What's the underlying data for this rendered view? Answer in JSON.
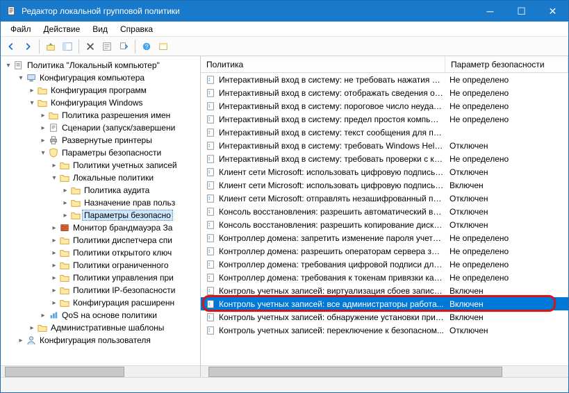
{
  "window": {
    "title": "Редактор локальной групповой политики"
  },
  "menu": {
    "file": "Файл",
    "action": "Действие",
    "view": "Вид",
    "help": "Справка"
  },
  "tree": {
    "root": "Политика \"Локальный компьютер\"",
    "items": [
      {
        "label": "Конфигурация компьютера",
        "depth": 1,
        "expanded": true,
        "icon": "computer"
      },
      {
        "label": "Конфигурация программ",
        "depth": 2,
        "expanded": false,
        "icon": "folder"
      },
      {
        "label": "Конфигурация Windows",
        "depth": 2,
        "expanded": true,
        "icon": "folder"
      },
      {
        "label": "Политика разрешения имен",
        "depth": 3,
        "expanded": false,
        "icon": "folder"
      },
      {
        "label": "Сценарии (запуск/завершени",
        "depth": 3,
        "expanded": false,
        "icon": "script"
      },
      {
        "label": "Развернутые принтеры",
        "depth": 3,
        "expanded": false,
        "icon": "printer"
      },
      {
        "label": "Параметры безопасности",
        "depth": 3,
        "expanded": true,
        "icon": "shield"
      },
      {
        "label": "Политики учетных записей",
        "depth": 4,
        "expanded": false,
        "icon": "folder"
      },
      {
        "label": "Локальные политики",
        "depth": 4,
        "expanded": true,
        "icon": "folder"
      },
      {
        "label": "Политика аудита",
        "depth": 5,
        "expanded": false,
        "icon": "folder"
      },
      {
        "label": "Назначение прав польз",
        "depth": 5,
        "expanded": false,
        "icon": "folder"
      },
      {
        "label": "Параметры безопасно",
        "depth": 5,
        "expanded": false,
        "icon": "folder",
        "selected": true
      },
      {
        "label": "Монитор брандмауэра За",
        "depth": 4,
        "expanded": false,
        "icon": "firewall"
      },
      {
        "label": "Политики диспетчера спи",
        "depth": 4,
        "expanded": false,
        "icon": "folder"
      },
      {
        "label": "Политики открытого ключ",
        "depth": 4,
        "expanded": false,
        "icon": "folder"
      },
      {
        "label": "Политики ограниченного",
        "depth": 4,
        "expanded": false,
        "icon": "folder"
      },
      {
        "label": "Политики управления при",
        "depth": 4,
        "expanded": false,
        "icon": "folder"
      },
      {
        "label": "Политики IP-безопасности",
        "depth": 4,
        "expanded": false,
        "icon": "folder"
      },
      {
        "label": "Конфигурация расширенн",
        "depth": 4,
        "expanded": false,
        "icon": "folder"
      },
      {
        "label": "QoS на основе политики",
        "depth": 3,
        "expanded": false,
        "icon": "qos"
      },
      {
        "label": "Административные шаблоны",
        "depth": 2,
        "expanded": false,
        "icon": "folder"
      },
      {
        "label": "Конфигурация пользователя",
        "depth": 1,
        "expanded": false,
        "icon": "user"
      }
    ]
  },
  "list": {
    "col1": "Политика",
    "col2": "Параметр безопасности",
    "rows": [
      {
        "label": "Интерактивный вход в систему: не требовать нажатия CT...",
        "value": "Не определено"
      },
      {
        "label": "Интерактивный вход в систему: отображать сведения о п...",
        "value": "Не определено"
      },
      {
        "label": "Интерактивный вход в систему: пороговое число неудач...",
        "value": "Не определено"
      },
      {
        "label": "Интерактивный вход в систему: предел простоя компьют...",
        "value": "Не определено"
      },
      {
        "label": "Интерактивный вход в систему: текст сообщения для по...",
        "value": ""
      },
      {
        "label": "Интерактивный вход в систему: требовать Windows Hello...",
        "value": "Отключен"
      },
      {
        "label": "Интерактивный вход в систему: требовать проверки с ка...",
        "value": "Не определено"
      },
      {
        "label": "Клиент сети Microsoft: использовать цифровую подпись ...",
        "value": "Отключен"
      },
      {
        "label": "Клиент сети Microsoft: использовать цифровую подпись ...",
        "value": "Включен"
      },
      {
        "label": "Клиент сети Microsoft: отправлять незашифрованный па...",
        "value": "Отключен"
      },
      {
        "label": "Консоль восстановления: разрешить автоматический вх...",
        "value": "Отключен"
      },
      {
        "label": "Консоль восстановления: разрешить копирование диске...",
        "value": "Отключен"
      },
      {
        "label": "Контроллер домена: запретить изменение пароля учетн...",
        "value": "Не определено"
      },
      {
        "label": "Контроллер домена: разрешить операторам сервера зад...",
        "value": "Не определено"
      },
      {
        "label": "Контроллер домена: требования цифровой подписи для ...",
        "value": "Не определено"
      },
      {
        "label": "Контроллер домена: требования к токенам привязки кан...",
        "value": "Не определено"
      },
      {
        "label": "Контроль учетных записей: виртуализация сбоев записи ...",
        "value": "Включен"
      },
      {
        "label": "Контроль учетных записей: все администраторы работа...",
        "value": "Включен",
        "selected": true,
        "highlighted": true
      },
      {
        "label": "Контроль учетных записей: обнаружение установки прил...",
        "value": "Включен"
      },
      {
        "label": "Контроль учетных записей: переключение к безопасном...",
        "value": "Отключен"
      }
    ]
  }
}
